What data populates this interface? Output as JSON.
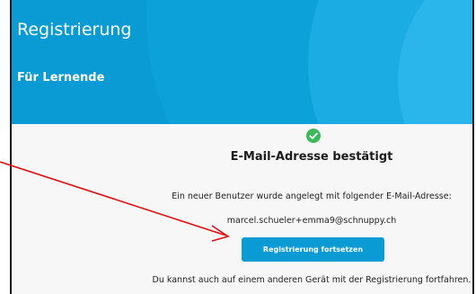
{
  "header": {
    "title": "Registrierung",
    "subtitle": "Für Lernende"
  },
  "confirmation": {
    "icon": "check-circle-icon",
    "title": "E-Mail-Adresse bestätigt",
    "info": "Ein neuer Benutzer wurde angelegt mit folgender E-Mail-Adresse:",
    "email": "marcel.schueler+emma9@schnuppy.ch",
    "continue_label": "Registrierung fortsetzen",
    "alt_device": "Du kannst auch auf einem anderen Gerät mit der Registrierung fortfahren."
  },
  "colors": {
    "brand": "#0a9bd4",
    "success": "#3cb95b",
    "annotation": "#e01010"
  }
}
